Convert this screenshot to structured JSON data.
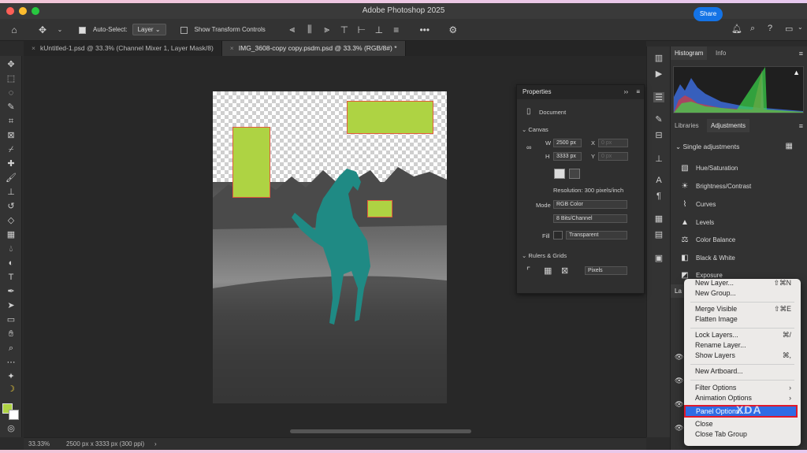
{
  "window": {
    "title": "Adobe Photoshop 2025"
  },
  "options_bar": {
    "auto_select_label": "Auto-Select:",
    "auto_select_value": "Layer",
    "show_transform_label": "Show Transform Controls",
    "more_label": "•••"
  },
  "share": {
    "label": "Share"
  },
  "tabs": [
    {
      "label": "kUntitled-1.psd @ 33.3% (Channel Mixer 1, Layer Mask/8)"
    },
    {
      "label": "IMG_3608-copy copy.psdm.psd @ 33.3% (RGB/8#) *"
    }
  ],
  "status": {
    "zoom": "33.33%",
    "info": "2500 px x 3333 px (300 ppi)"
  },
  "right_panel": {
    "tabs_top": [
      "Histogram",
      "Info"
    ],
    "tabs_mid": [
      "Libraries",
      "Adjustments"
    ],
    "single_adjustments": "Single adjustments",
    "adjustments": [
      {
        "label": "Hue/Saturation",
        "icon": "hue-saturation-icon"
      },
      {
        "label": "Brightness/Contrast",
        "icon": "brightness-icon"
      },
      {
        "label": "Curves",
        "icon": "curves-icon"
      },
      {
        "label": "Levels",
        "icon": "levels-icon"
      },
      {
        "label": "Color Balance",
        "icon": "color-balance-icon"
      },
      {
        "label": "Black & White",
        "icon": "black-white-icon"
      },
      {
        "label": "Exposure",
        "icon": "exposure-icon"
      }
    ],
    "layers_tab_fragment": "La"
  },
  "properties": {
    "title": "Properties",
    "document_label": "Document",
    "canvas_label": "Canvas",
    "w_label": "W",
    "w_value": "2500 px",
    "h_label": "H",
    "h_value": "3333 px",
    "x_label": "X",
    "x_value": "0 px",
    "y_label": "Y",
    "y_value": "0 px",
    "resolution": "Resolution: 300 pixels/inch",
    "mode_label": "Mode",
    "mode_value": "RGB Color",
    "bits_value": "8 Bits/Channel",
    "fill_label": "Fill",
    "fill_value": "Transparent",
    "rulers_label": "Rulers & Grids",
    "units_value": "Pixels"
  },
  "context_menu": {
    "items": [
      {
        "label": "New Layer...",
        "shortcut": "⇧⌘N"
      },
      {
        "label": "New Group...",
        "shortcut": ""
      },
      {
        "label": "Merge Visible",
        "shortcut": "⇧⌘E"
      },
      {
        "label": "Flatten Image",
        "shortcut": ""
      },
      {
        "label": "Lock Layers...",
        "shortcut": "⌘/"
      },
      {
        "label": "Rename Layer...",
        "shortcut": ""
      },
      {
        "label": "Show Layers",
        "shortcut": "⌘,"
      },
      {
        "label": "New Artboard...",
        "shortcut": ""
      },
      {
        "label": "Filter Options",
        "shortcut": "›"
      },
      {
        "label": "Animation Options",
        "shortcut": "›"
      },
      {
        "label": "Panel Options...",
        "shortcut": ""
      },
      {
        "label": "Close",
        "shortcut": ""
      },
      {
        "label": "Close Tab Group",
        "shortcut": ""
      }
    ]
  },
  "watermark": {
    "text": "XDA"
  },
  "colors": {
    "accent": "#2f6ce5",
    "highlight_border": "#e0192b",
    "rect_fill": "#aed343",
    "horse": "#1f8a84"
  }
}
